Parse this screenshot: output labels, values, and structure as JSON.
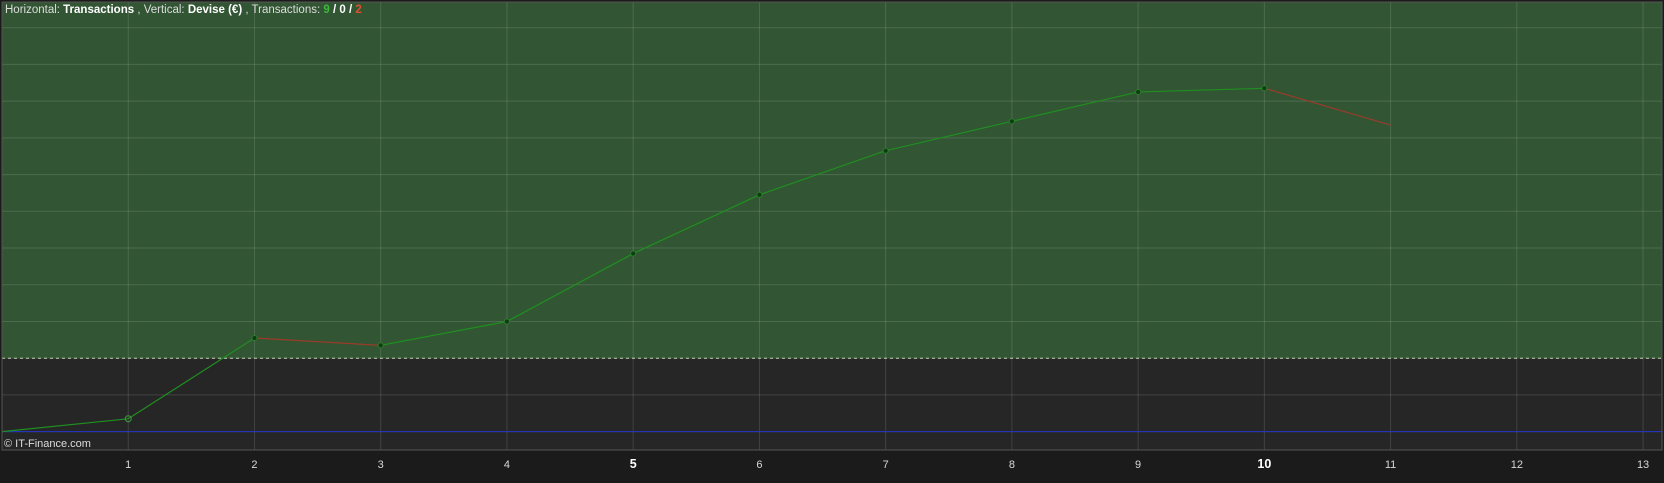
{
  "header": {
    "horizontal_prefix": "Horizontal: ",
    "horizontal_value": "Transactions",
    "vertical_prefix": ", Vertical: ",
    "vertical_value": "Devise (€)",
    "transactions_prefix": ", Transactions: ",
    "wins": "9",
    "sep1": " / ",
    "neutral": "0",
    "sep2": " / ",
    "losses": "2"
  },
  "watermark": "© IT-Finance.com",
  "colors": {
    "profit_zone": "#325534",
    "loss_zone": "#262626",
    "win_line": "#1f8f1f",
    "loss_line": "#9a3b2a",
    "baseline": "#2233cc",
    "zero_line": "#bcd4b0",
    "win_text": "#3cb93c",
    "loss_text": "#e0502a"
  },
  "chart_data": {
    "type": "line",
    "x_ticks": [
      1,
      2,
      3,
      4,
      5,
      6,
      7,
      8,
      9,
      10,
      11,
      12,
      13
    ],
    "x_tick_labels": [
      "1",
      "2",
      "3",
      "4",
      "5",
      "6",
      "7",
      "8",
      "9",
      "10",
      "11",
      "12",
      "13"
    ],
    "bold_ticks": [
      5,
      10
    ],
    "xlim": [
      0,
      13.15
    ],
    "ylim": [
      -1.5,
      10.7
    ],
    "zero_level": 1,
    "baseline_level": -1,
    "grid": true,
    "series": [
      {
        "x": [
          0,
          1,
          2,
          3,
          4,
          5,
          6,
          7,
          8,
          9,
          10,
          11
        ],
        "y": [
          -1,
          -0.65,
          1.55,
          1.35,
          2.0,
          3.85,
          5.45,
          6.65,
          7.45,
          8.25,
          8.35,
          7.35
        ],
        "segment_results": [
          "win",
          "win",
          "loss",
          "win",
          "win",
          "win",
          "win",
          "win",
          "win",
          "win",
          "loss"
        ]
      }
    ]
  }
}
